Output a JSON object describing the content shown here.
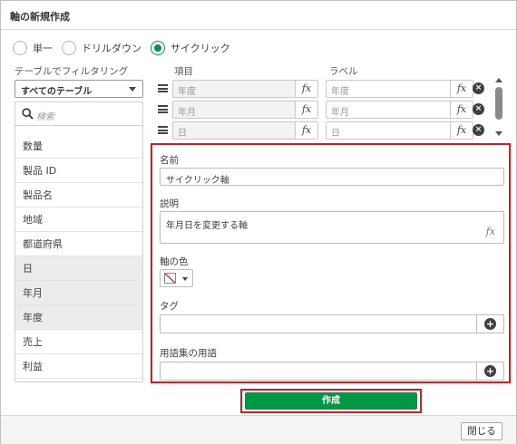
{
  "dialog": {
    "title": "軸の新規作成"
  },
  "mode": {
    "options": [
      "単一",
      "ドリルダウン",
      "サイクリック"
    ],
    "selected": "サイクリック"
  },
  "filter": {
    "label": "テーブルでフィルタリング",
    "selected": "すべてのテーブル",
    "search_placeholder": "検索",
    "fields": [
      "数量",
      "製品 ID",
      "製品名",
      "地域",
      "都道府県",
      "日",
      "年月",
      "年度",
      "売上",
      "利益"
    ],
    "selected_fields": [
      "日",
      "年月",
      "年度"
    ]
  },
  "columns": {
    "item": "項目",
    "label": "ラベル"
  },
  "rows": [
    {
      "item": "年度",
      "label": "年度"
    },
    {
      "item": "年月",
      "label": "年月"
    },
    {
      "item": "日",
      "label": "日"
    }
  ],
  "fx_symbol": "fx",
  "form": {
    "name_label": "名前",
    "name_value": "サイクリック軸",
    "description_label": "説明",
    "description_value": "年月日を変更する軸",
    "color_label": "軸の色",
    "tag_label": "タグ",
    "glossary_label": "用語集の用語"
  },
  "actions": {
    "create": "作成",
    "close": "閉じる"
  },
  "colors": {
    "accent": "#009845",
    "highlight": "#d71920"
  }
}
